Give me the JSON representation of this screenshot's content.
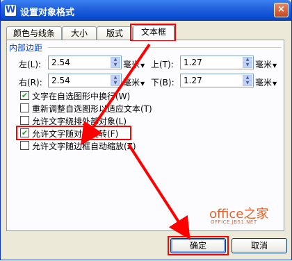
{
  "window": {
    "title": "设置对象格式",
    "app_icon": "W",
    "close": "×"
  },
  "tabs": [
    {
      "label": "颜色与线条"
    },
    {
      "label": "大小"
    },
    {
      "label": "版式"
    },
    {
      "label": "文本框"
    }
  ],
  "margins": {
    "group_label": "内部边距",
    "left": {
      "label": "左(L):",
      "value": "2.54",
      "unit": "毫米"
    },
    "right": {
      "label": "右(R):",
      "value": "2.54",
      "unit": "毫米"
    },
    "top": {
      "label": "上(T):",
      "value": "1.27",
      "unit": "毫米"
    },
    "bottom": {
      "label": "下(B):",
      "value": "1.27",
      "unit": "毫米"
    }
  },
  "options": [
    {
      "label": "文字在自选图形中换行(W)",
      "checked": true
    },
    {
      "label": "重新调整自选图形以适应文本(T)",
      "checked": false
    },
    {
      "label": "允许文字绕排外部对象(L)",
      "checked": false
    },
    {
      "label": "允许文字随对象旋转(F)",
      "checked": true
    },
    {
      "label": "允许文字随边框自动缩放(Z)",
      "checked": false
    }
  ],
  "buttons": {
    "ok": "确定",
    "cancel": "取消"
  },
  "watermark": {
    "main": "office之家",
    "sub": "OFFICE.JB51.NET"
  },
  "colors": {
    "highlight": "#ff0000",
    "title_bar": "#0a4fd4",
    "check": "#21a121"
  }
}
